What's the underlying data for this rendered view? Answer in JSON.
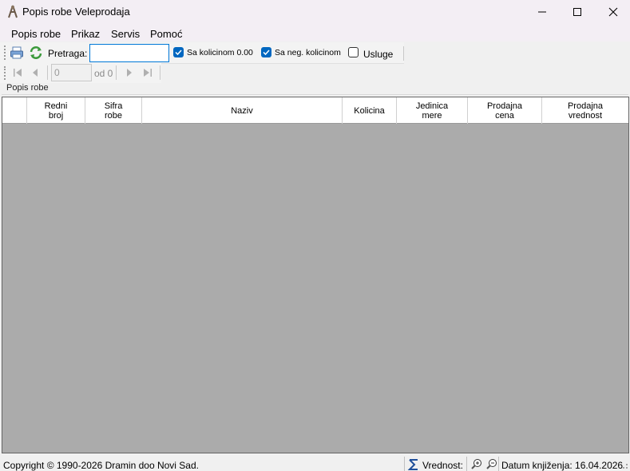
{
  "window": {
    "title": "Popis robe",
    "subtitle": "Veleprodaja"
  },
  "menu": {
    "items": [
      "Popis robe",
      "Prikaz",
      "Servis",
      "Pomoć"
    ]
  },
  "toolbar": {
    "search_label": "Pretraga:",
    "search_value": "",
    "checkboxes": [
      {
        "label": "Sa kolicinom 0.00",
        "checked": true
      },
      {
        "label": "Sa neg. kolicinom",
        "checked": true
      },
      {
        "label": "Usluge",
        "checked": false
      }
    ]
  },
  "navigator": {
    "page_value": "0",
    "page_total": "od 0"
  },
  "section": {
    "label": "Popis robe"
  },
  "grid": {
    "columns": [
      "Redni\nbroj",
      "Sifra\nrobe",
      "Naziv",
      "Kolicina",
      "Jedinica\nmere",
      "Prodajna\ncena",
      "Prodajna\nvrednost"
    ],
    "rows": []
  },
  "statusbar": {
    "copyright": "Copyright © 1990-2026 Dramin doo Novi Sad.",
    "vrednost_label": "Vrednost:",
    "datum_label": "Datum knjiženja: 16.04.2026"
  },
  "colors": {
    "accent": "#0067c0",
    "grid_background": "#ababab",
    "titlebar": "#f3eef4"
  }
}
